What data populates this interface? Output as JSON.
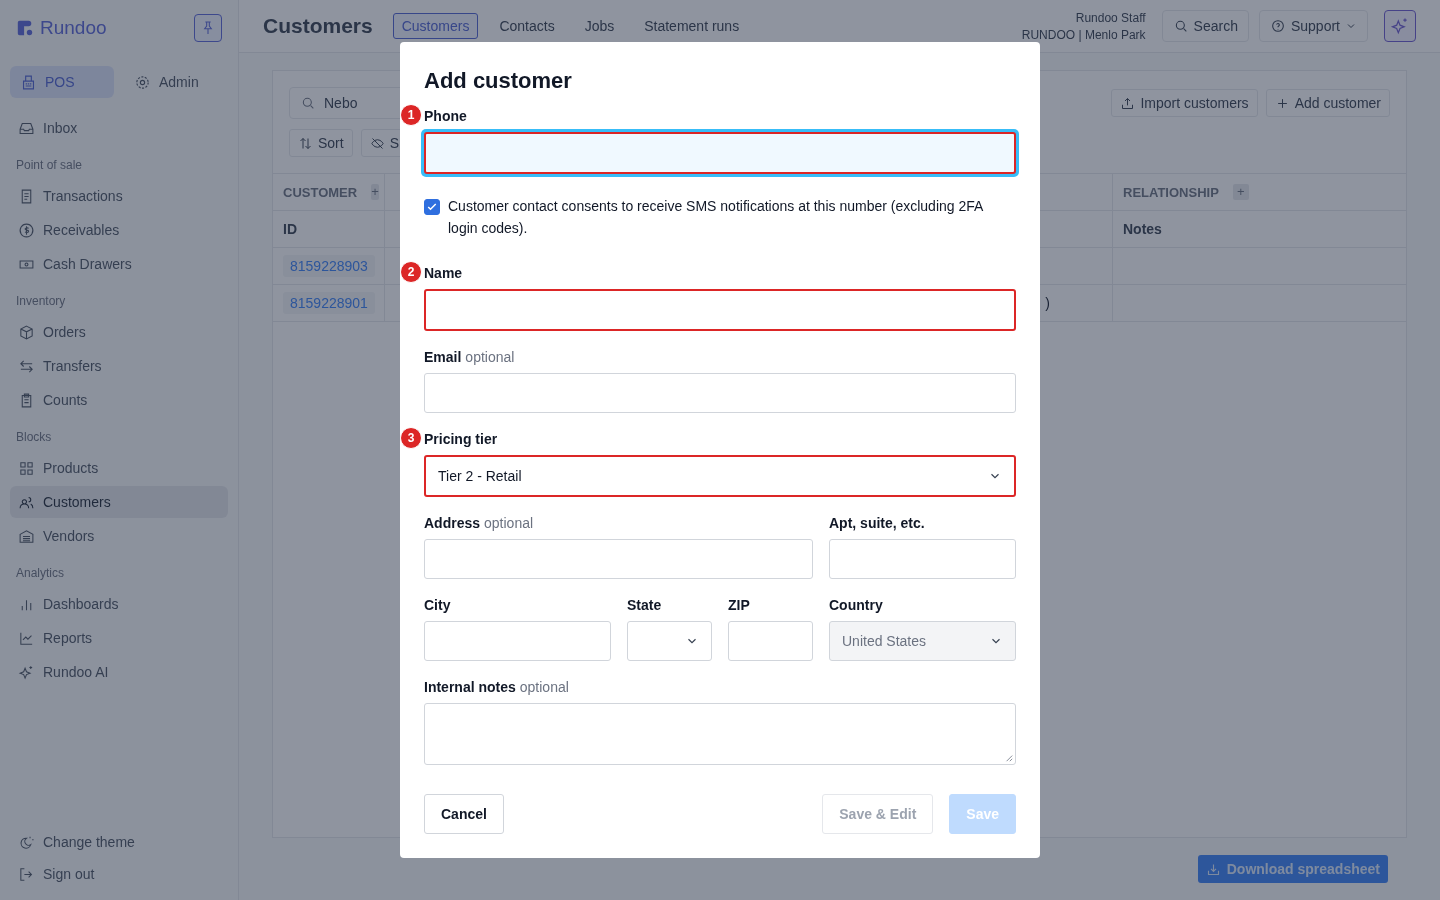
{
  "sidebar": {
    "brand": "Rundoo",
    "modes": [
      {
        "label": "POS",
        "selected": true
      },
      {
        "label": "Admin",
        "selected": false
      }
    ],
    "groups": [
      {
        "items": [
          {
            "label": "Inbox",
            "selected": false
          }
        ]
      },
      {
        "heading": "Point of sale",
        "items": [
          {
            "label": "Transactions",
            "selected": false
          },
          {
            "label": "Receivables",
            "selected": false
          },
          {
            "label": "Cash Drawers",
            "selected": false
          }
        ]
      },
      {
        "heading": "Inventory",
        "items": [
          {
            "label": "Orders",
            "selected": false
          },
          {
            "label": "Transfers",
            "selected": false
          },
          {
            "label": "Counts",
            "selected": false
          }
        ]
      },
      {
        "heading": "Blocks",
        "items": [
          {
            "label": "Products",
            "selected": false
          },
          {
            "label": "Customers",
            "selected": true
          },
          {
            "label": "Vendors",
            "selected": false
          }
        ]
      },
      {
        "heading": "Analytics",
        "items": [
          {
            "label": "Dashboards",
            "selected": false
          },
          {
            "label": "Reports",
            "selected": false
          },
          {
            "label": "Rundoo AI",
            "selected": false
          }
        ]
      }
    ],
    "footer_items": [
      "Change theme",
      "Sign out"
    ]
  },
  "header": {
    "title": "Customers",
    "tabs": [
      {
        "label": "Customers",
        "selected": true
      },
      {
        "label": "Contacts",
        "selected": false
      },
      {
        "label": "Jobs",
        "selected": false
      },
      {
        "label": "Statement runs",
        "selected": false
      }
    ],
    "user": {
      "name": "Rundoo Staff",
      "org": "RUNDOO | Menlo Park"
    },
    "search": "Search",
    "support": "Support"
  },
  "toolbar": {
    "search_value": "Nebo",
    "sort": "Sort",
    "hide": "S",
    "import": "Import customers",
    "add": "Add customer"
  },
  "table": {
    "groups": [
      {
        "label": "CUSTOMER",
        "add": "+"
      },
      {
        "label": "RELATIONSHIP",
        "add": "+"
      }
    ],
    "columns": [
      "ID",
      "Notes"
    ],
    "rows": [
      {
        "id": "8159228903",
        "column_2": ""
      },
      {
        "id": "8159228901",
        "column_2": ")"
      }
    ]
  },
  "download": "Download spreadsheet",
  "dialog": {
    "title": "Add customer",
    "fields": [
      {
        "kind": "text",
        "label": "Phone",
        "marker": "1",
        "highlighted": true,
        "focused": true
      },
      {
        "kind": "checkbox",
        "label": "Customer contact consents to receive SMS notifications at this number (excluding 2FA login codes).",
        "checked": true
      },
      {
        "kind": "text",
        "label": "Name",
        "marker": "2",
        "highlighted": true,
        "focused": false
      },
      {
        "kind": "text",
        "label": "Email",
        "note": "optional",
        "highlighted": false,
        "focused": false
      },
      {
        "kind": "select",
        "label": "Pricing tier",
        "marker": "3",
        "value": "Tier 2 - Retail",
        "highlighted": true,
        "disabled": false
      },
      {
        "kind": "text",
        "label": "Address",
        "note": "optional",
        "highlighted": false,
        "focused": false
      },
      {
        "kind": "text",
        "label": "Apt, suite, etc.",
        "highlighted": false,
        "focused": false
      },
      {
        "kind": "text",
        "label": "City",
        "highlighted": false,
        "focused": false
      },
      {
        "kind": "select",
        "label": "State",
        "highlighted": false,
        "disabled": false
      },
      {
        "kind": "text",
        "label": "ZIP",
        "highlighted": false,
        "focused": false
      },
      {
        "kind": "select",
        "label": "Country",
        "value": "United States",
        "highlighted": false,
        "disabled": true
      },
      {
        "kind": "textarea",
        "label": "Internal notes",
        "note": "optional",
        "highlighted": false
      }
    ],
    "buttons": [
      {
        "label": "Cancel",
        "kind": "secondary",
        "disabled": false
      },
      {
        "label": "Save & Edit",
        "kind": "secondary",
        "disabled": true
      },
      {
        "label": "Save",
        "kind": "primary",
        "disabled": true
      }
    ]
  }
}
